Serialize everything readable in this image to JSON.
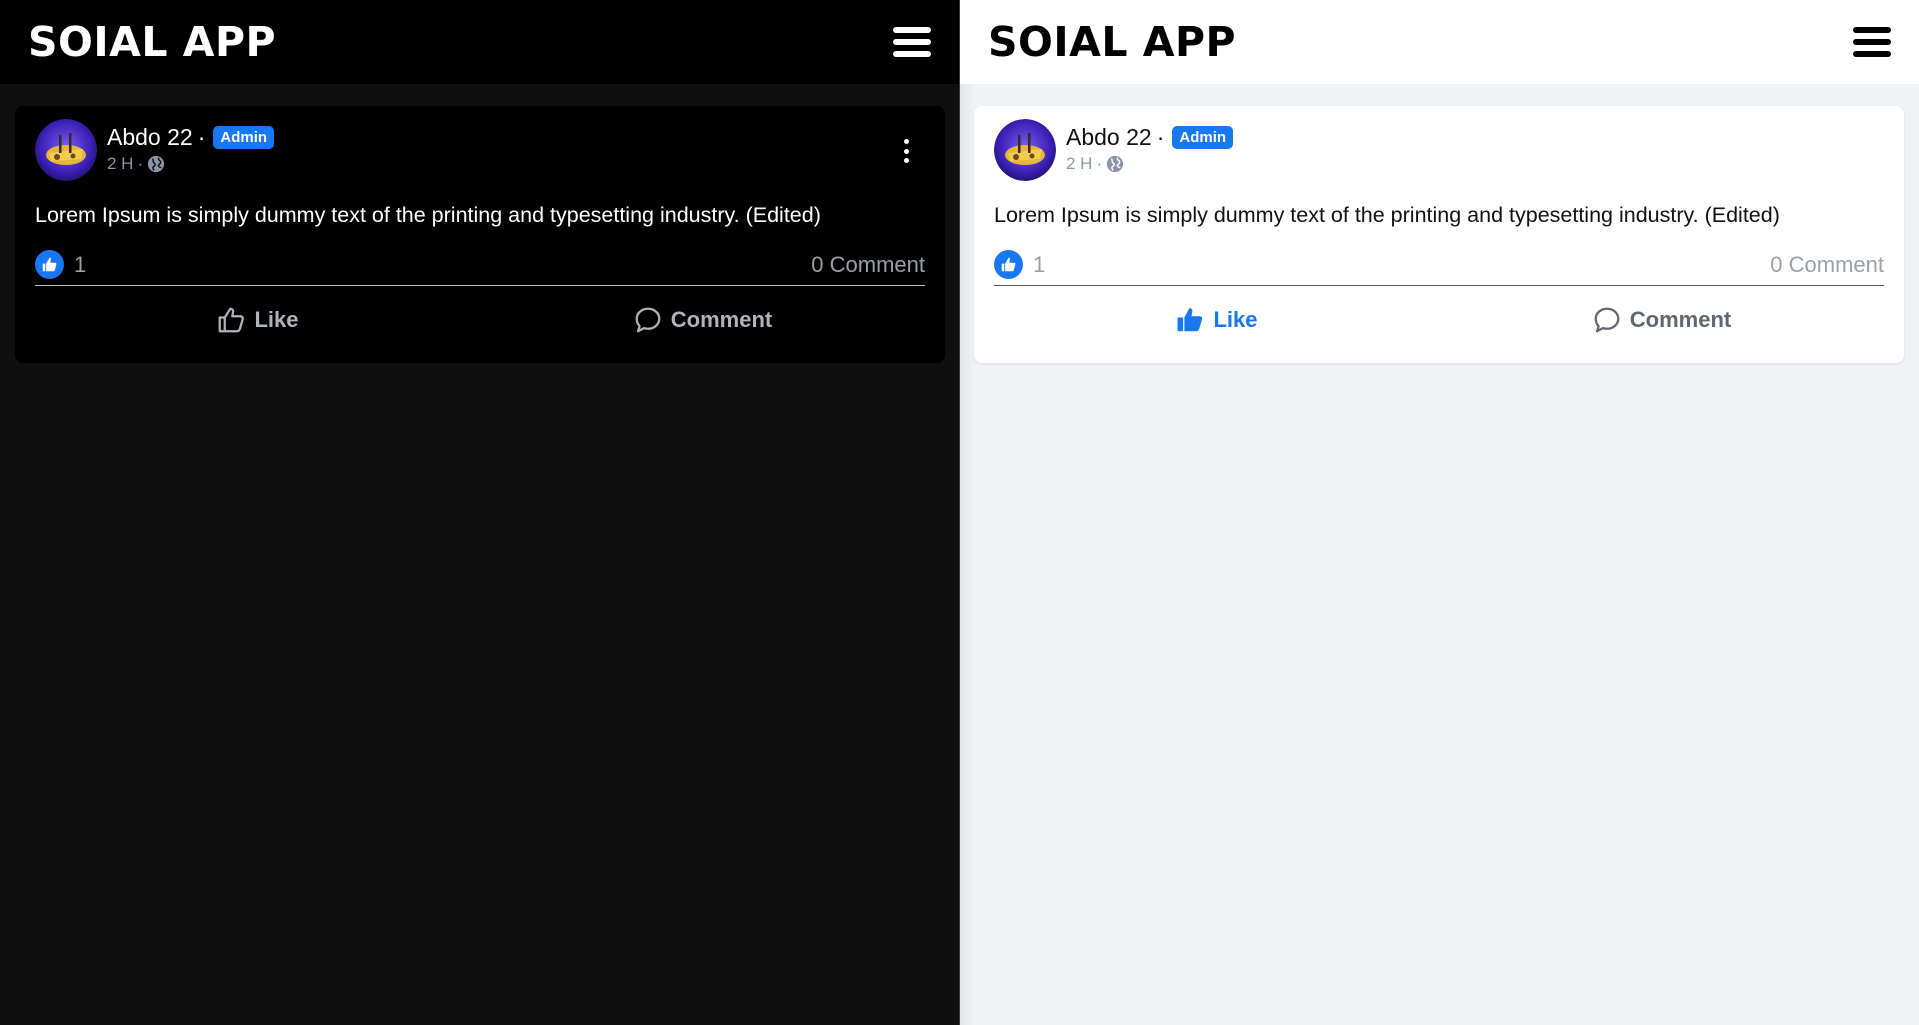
{
  "panels": [
    {
      "theme": "dark",
      "header": {
        "title": "SOIAL APP"
      },
      "post": {
        "author": "Abdo 22",
        "dot": "·",
        "badge": "Admin",
        "time": "2 H",
        "time_sep": "·",
        "text": "Lorem Ipsum is simply dummy text of the printing and typesetting industry. (Edited)",
        "like_count": "1",
        "comment_count": "0 Comment",
        "actions": {
          "like": "Like",
          "comment": "Comment"
        }
      }
    },
    {
      "theme": "light",
      "header": {
        "title": "SOIAL APP"
      },
      "post": {
        "author": "Abdo 22",
        "dot": "·",
        "badge": "Admin",
        "time": "2 H",
        "time_sep": "·",
        "text": "Lorem Ipsum is simply dummy text of the printing and typesetting industry. (Edited)",
        "like_count": "1",
        "comment_count": "0 Comment",
        "actions": {
          "like": "Like",
          "comment": "Comment"
        }
      }
    }
  ],
  "colors": {
    "accent": "#1877f2",
    "dark_bg": "#0f0f0f",
    "dark_card": "#000000",
    "light_bg": "#f0f2f5",
    "light_card": "#ffffff",
    "muted": "#8a96a8"
  },
  "icons": [
    "menu-icon",
    "avatar-image",
    "globe-icon",
    "kebab-menu-icon",
    "like-reaction-icon",
    "thumbs-up-icon",
    "comment-icon"
  ]
}
